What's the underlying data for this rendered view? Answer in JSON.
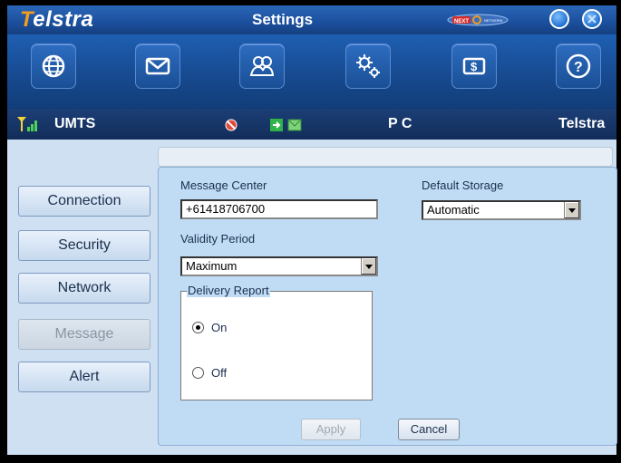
{
  "window": {
    "brand": "Telstra",
    "title": "Settings",
    "next_logo_text": "NEXT G NETWORK"
  },
  "toolbar": {
    "buttons": [
      {
        "name": "internet",
        "icon": "globe-icon"
      },
      {
        "name": "sms",
        "icon": "envelope-icon"
      },
      {
        "name": "contacts",
        "icon": "people-icon"
      },
      {
        "name": "settings",
        "icon": "gears-icon"
      },
      {
        "name": "usage",
        "icon": "dollar-icon"
      },
      {
        "name": "help",
        "icon": "help-icon"
      }
    ]
  },
  "status": {
    "network_type": "UMTS",
    "mode": "P C",
    "carrier": "Telstra"
  },
  "nav": {
    "items": [
      {
        "label": "Connection",
        "enabled": true
      },
      {
        "label": "Security",
        "enabled": true
      },
      {
        "label": "Network",
        "enabled": true
      },
      {
        "label": "Message",
        "enabled": false
      },
      {
        "label": "Alert",
        "enabled": true
      }
    ]
  },
  "form": {
    "message_center_label": "Message Center",
    "message_center_value": "+61418706700",
    "default_storage_label": "Default Storage",
    "default_storage_value": "Automatic",
    "validity_period_label": "Validity Period",
    "validity_period_value": "Maximum",
    "delivery_report_label": "Delivery Report",
    "delivery_on_label": "On",
    "delivery_off_label": "Off",
    "delivery_selected": "On",
    "apply_label": "Apply",
    "cancel_label": "Cancel"
  },
  "colors": {
    "brand_orange": "#f39c1f",
    "header_blue": "#1b4f9c",
    "panel_blue": "#c0dcf5"
  }
}
